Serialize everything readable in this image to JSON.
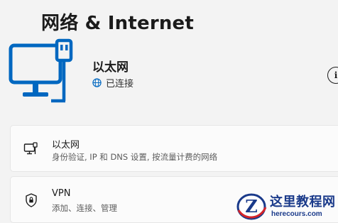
{
  "header": {
    "title": "网络 & Internet"
  },
  "hero": {
    "icon": "ethernet-monitor-icon",
    "name": "以太网",
    "status_icon": "globe-icon",
    "status": "已连接",
    "info_icon": "info-icon",
    "info_glyph": "i"
  },
  "cards": [
    {
      "icon": "ethernet-icon",
      "title": "以太网",
      "description": "身份验证, IP 和 DNS 设置, 按流量计费的网络"
    },
    {
      "icon": "shield-icon",
      "title": "VPN",
      "description": "添加、连接、管理"
    }
  ],
  "watermark": {
    "title": "这里教程网",
    "url": "herecours.com"
  },
  "colors": {
    "accent": "#0067c0",
    "background": "#f3f3f3",
    "card": "#fbfbfb"
  }
}
